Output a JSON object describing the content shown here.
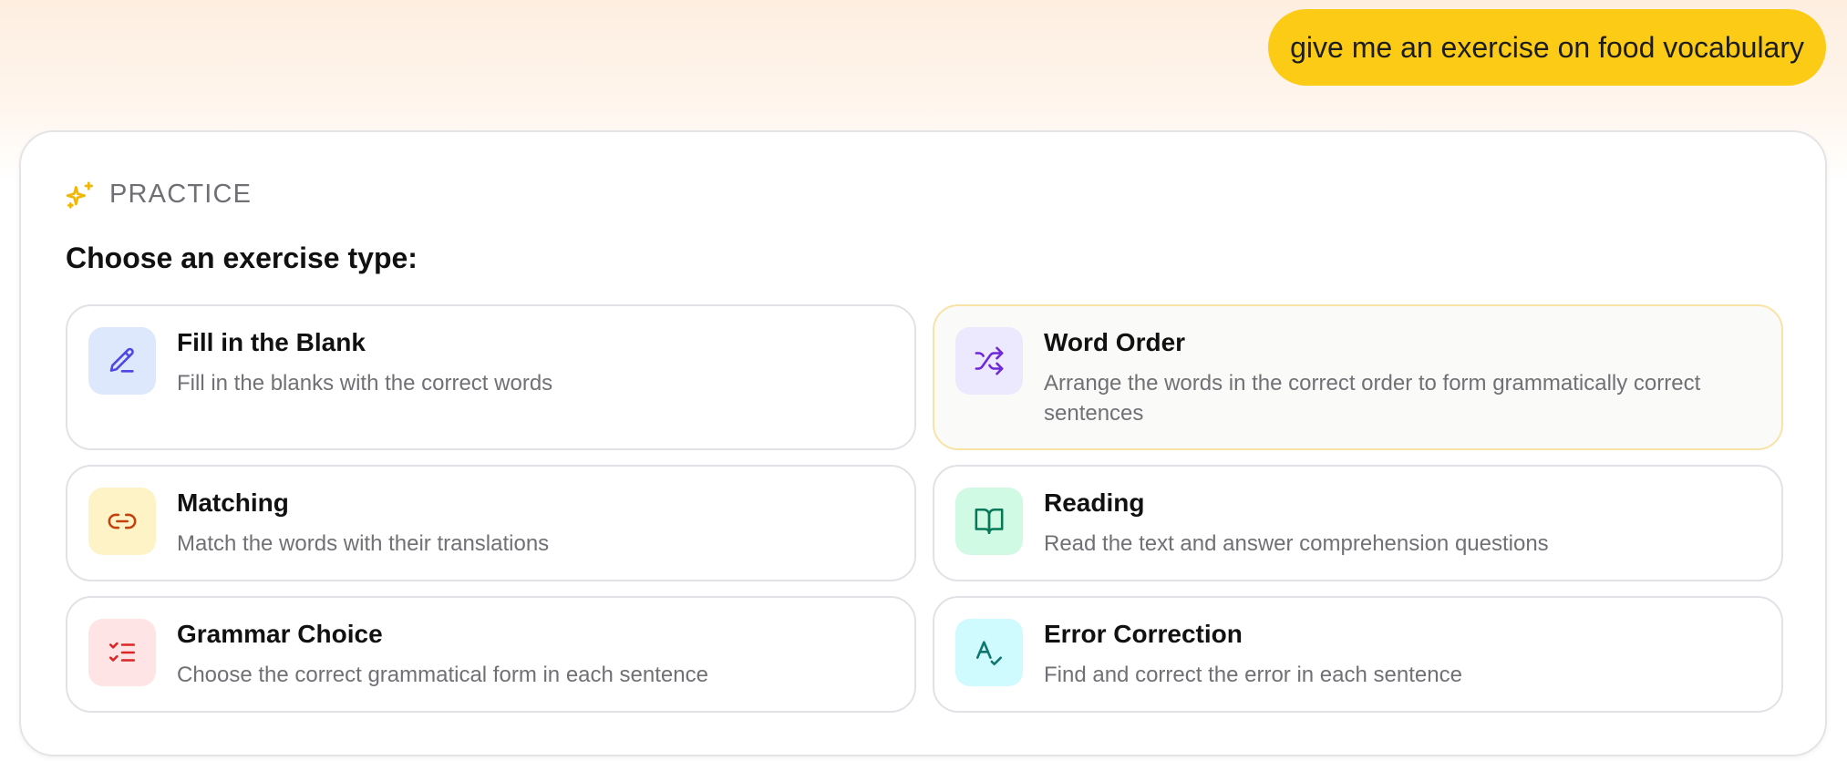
{
  "chat": {
    "user_message": "give me an exercise on food vocabulary"
  },
  "practice": {
    "header_label": "PRACTICE",
    "header_icon": "sparkle-icon",
    "prompt": "Choose an exercise type:",
    "accent_color": "#fbcb16",
    "options": [
      {
        "title": "Fill in the Blank",
        "description": "Fill in the blanks with the correct words",
        "icon": "pencil-icon",
        "icon_bg": "#dde8fd",
        "icon_color": "#4f46e5",
        "selected": false
      },
      {
        "title": "Word Order",
        "description": "Arrange the words in the correct order to form grammatically correct sentences",
        "icon": "shuffle-icon",
        "icon_bg": "#ece8fd",
        "icon_color": "#6d28d9",
        "selected": true
      },
      {
        "title": "Matching",
        "description": "Match the words with their translations",
        "icon": "link-icon",
        "icon_bg": "#fef3c7",
        "icon_color": "#c2410c",
        "selected": false
      },
      {
        "title": "Reading",
        "description": "Read the text and answer comprehension questions",
        "icon": "book-open-icon",
        "icon_bg": "#d1fae5",
        "icon_color": "#047857",
        "selected": false
      },
      {
        "title": "Grammar Choice",
        "description": "Choose the correct grammatical form in each sentence",
        "icon": "list-check-icon",
        "icon_bg": "#ffe4e6",
        "icon_color": "#dc2626",
        "selected": false
      },
      {
        "title": "Error Correction",
        "description": "Find and correct the error in each sentence",
        "icon": "spell-check-icon",
        "icon_bg": "#cffafe",
        "icon_color": "#0f766e",
        "selected": false
      }
    ]
  }
}
